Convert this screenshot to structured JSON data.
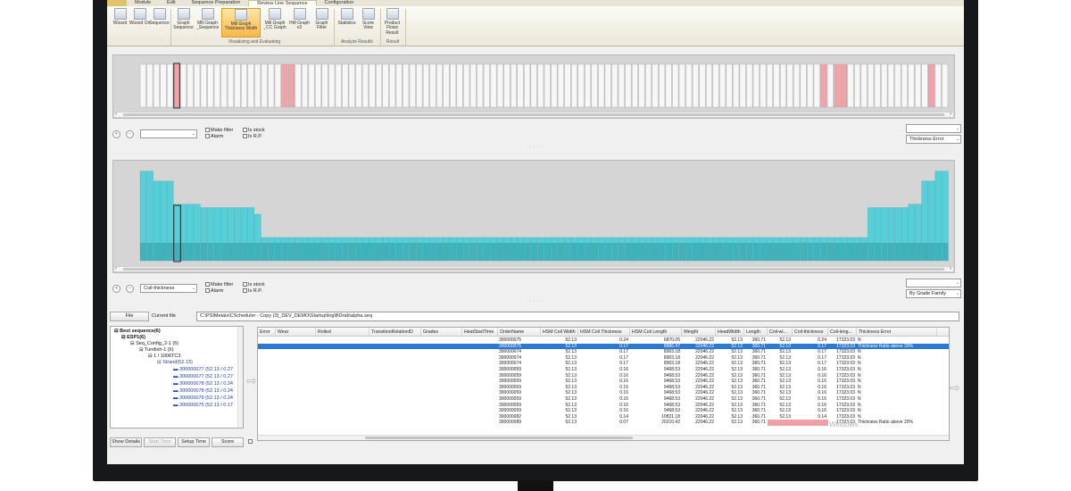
{
  "ribbon": {
    "tabs": [
      "Module",
      "Edit",
      "Sequence Preparation",
      "Review Line Sequence",
      "Configuration"
    ],
    "active_tab": "Review Line Sequence",
    "buttons": [
      {
        "label": "Wizard"
      },
      {
        "label": "Wizard Ori"
      },
      {
        "label": "Sequence"
      },
      {
        "label": "Graph Sequence"
      },
      {
        "label": "Mill Graph _Sequence"
      },
      {
        "label": "Mill Graph Thickness Width"
      },
      {
        "label": "Mill Graph _CC Graph"
      },
      {
        "label": "HM Graph v3"
      },
      {
        "label": "Graph Filter"
      },
      {
        "label": "Statistics"
      },
      {
        "label": "Score View"
      },
      {
        "label": "Product Flows Result"
      }
    ],
    "groups": [
      "Visualizing and Evaluating",
      "Analyze Results",
      "Result"
    ]
  },
  "top_panel": {
    "combo_left": "",
    "combo_right_top": "",
    "combo_right": "Thickness Error",
    "filters": [
      "Make filter",
      "Alarm",
      "Is stock",
      "Is R.P."
    ],
    "bar_label": "300000075"
  },
  "bottom_panel": {
    "combo_left": "Coil-thickness",
    "combo_right_top": "",
    "combo_right": "By Grade Family",
    "filters": [
      "Make filter",
      "Alarm",
      "Is stock",
      "Is R.P."
    ]
  },
  "file_row": {
    "file_button": "File",
    "current_file_label": "Current file",
    "path": "C:\\PSIMetals\\CScheduler - Copy (3)_DEV_DEMO\\Startup\\log\\BDrab\\alpha.seq"
  },
  "tree": {
    "nodes": [
      {
        "label": "Best sequence(6)"
      },
      {
        "label": "ESP1(6)"
      },
      {
        "label": "Seq_Config_2-1 (6)"
      },
      {
        "label": "Tundish-1 (6)"
      },
      {
        "label": "1 / 1006TC3"
      },
      {
        "label": "Strand(52.13)"
      },
      {
        "label": "300000077 (52.13 / 0.27"
      },
      {
        "label": "300000077 (52.13 / 0.27"
      },
      {
        "label": "300000078 (52.13 / 0.24"
      },
      {
        "label": "300000078 (52.13 / 0.24"
      },
      {
        "label": "300000079 (52.13 / 0.24"
      },
      {
        "label": "300000075 (52.13 / 0.17"
      }
    ],
    "buttons": [
      "Show Details",
      "Start Time",
      "Setup Time",
      "Score"
    ]
  },
  "grid": {
    "columns": [
      "Error",
      "Wear",
      "Rolled",
      "TransitionRelationID",
      "Grades",
      "HeatStartTime",
      "OrderName",
      "HSM Coil Width",
      "HSM Coil Thickness",
      "HSM Coil Length",
      "Weight",
      "HeadWidth",
      "Length",
      "Coil-wi...",
      "Coil-thickness",
      "Coil-leng...",
      "Thickness Error"
    ],
    "rows": [
      [
        "300000075",
        "52.13",
        "0.24",
        "6870.05",
        "22046.22",
        "52.13",
        "360.71",
        "52.13",
        "0.24",
        "17323.03",
        "N"
      ],
      [
        "300000075",
        "52.13",
        "0.17",
        "8886.47",
        "22046.22",
        "52.13",
        "360.71",
        "52.13",
        "0.17",
        "17323.03",
        "Thickness Ratio above 20%"
      ],
      [
        "300000074",
        "52.13",
        "0.17",
        "8903.18",
        "22046.22",
        "52.13",
        "360.71",
        "52.13",
        "0.17",
        "17323.03",
        "N"
      ],
      [
        "300000074",
        "52.13",
        "0.17",
        "8903.18",
        "22046.22",
        "52.13",
        "360.71",
        "52.13",
        "0.17",
        "17323.03",
        "N"
      ],
      [
        "300000074",
        "52.13",
        "0.17",
        "8903.18",
        "22046.22",
        "52.13",
        "360.71",
        "52.13",
        "0.17",
        "17323.03",
        "N"
      ],
      [
        "300000059",
        "52.13",
        "0.16",
        "9468.53",
        "22046.22",
        "52.13",
        "360.71",
        "52.13",
        "0.16",
        "17323.03",
        "N"
      ],
      [
        "300000059",
        "52.13",
        "0.16",
        "9468.53",
        "22046.22",
        "52.13",
        "360.71",
        "52.13",
        "0.16",
        "17323.03",
        "N"
      ],
      [
        "300000059",
        "52.13",
        "0.16",
        "9468.53",
        "22046.22",
        "52.13",
        "360.71",
        "52.13",
        "0.16",
        "17323.03",
        "N"
      ],
      [
        "300000059",
        "52.13",
        "0.16",
        "9468.53",
        "22046.22",
        "52.13",
        "360.71",
        "52.13",
        "0.16",
        "17323.03",
        "N"
      ],
      [
        "300000059",
        "52.13",
        "0.16",
        "9468.53",
        "22046.22",
        "52.13",
        "360.71",
        "52.13",
        "0.16",
        "17323.03",
        "N"
      ],
      [
        "300000059",
        "52.13",
        "0.16",
        "9468.53",
        "22046.22",
        "52.13",
        "360.71",
        "52.13",
        "0.16",
        "17323.03",
        "N"
      ],
      [
        "300000059",
        "52.13",
        "0.16",
        "9468.53",
        "22046.22",
        "52.13",
        "360.71",
        "52.13",
        "0.16",
        "17323.03",
        "N"
      ],
      [
        "300000059",
        "52.13",
        "0.16",
        "9468.53",
        "22046.22",
        "52.13",
        "360.71",
        "52.13",
        "0.16",
        "17323.03",
        "N"
      ],
      [
        "300000082",
        "52.13",
        "0.14",
        "10821.18",
        "22046.22",
        "52.13",
        "360.71",
        "52.13",
        "0.14",
        "17323.03",
        "N"
      ],
      [
        "300000089",
        "52.13",
        "0.07",
        "20210.42",
        "22046.22",
        "52.13",
        "360.71",
        "52.13",
        "0.07",
        "17323.03",
        "Thickness Ratio above 20%"
      ]
    ],
    "selected_row": 1,
    "watermark": "Windows"
  },
  "colors": {
    "accent": "#2a7ad5",
    "bar": "#56cfd8",
    "highlight": "#f3a3a8",
    "ribbon_active": "#f5b84a"
  },
  "chart_data": [
    {
      "type": "bar",
      "ylabel": "",
      "series_count": 1,
      "bar_count": 120,
      "highlighted_bars": [
        5,
        21,
        22,
        101,
        103,
        104,
        117
      ]
    },
    {
      "type": "bar",
      "bar_count": 120,
      "values": [
        0.27,
        0.27,
        0.24,
        0.24,
        0.24,
        0.17,
        0.17,
        0.17,
        0.17,
        0.16,
        0.16,
        0.16,
        0.16,
        0.16,
        0.16,
        0.16,
        0.16,
        0.14,
        0.07
      ]
    }
  ]
}
